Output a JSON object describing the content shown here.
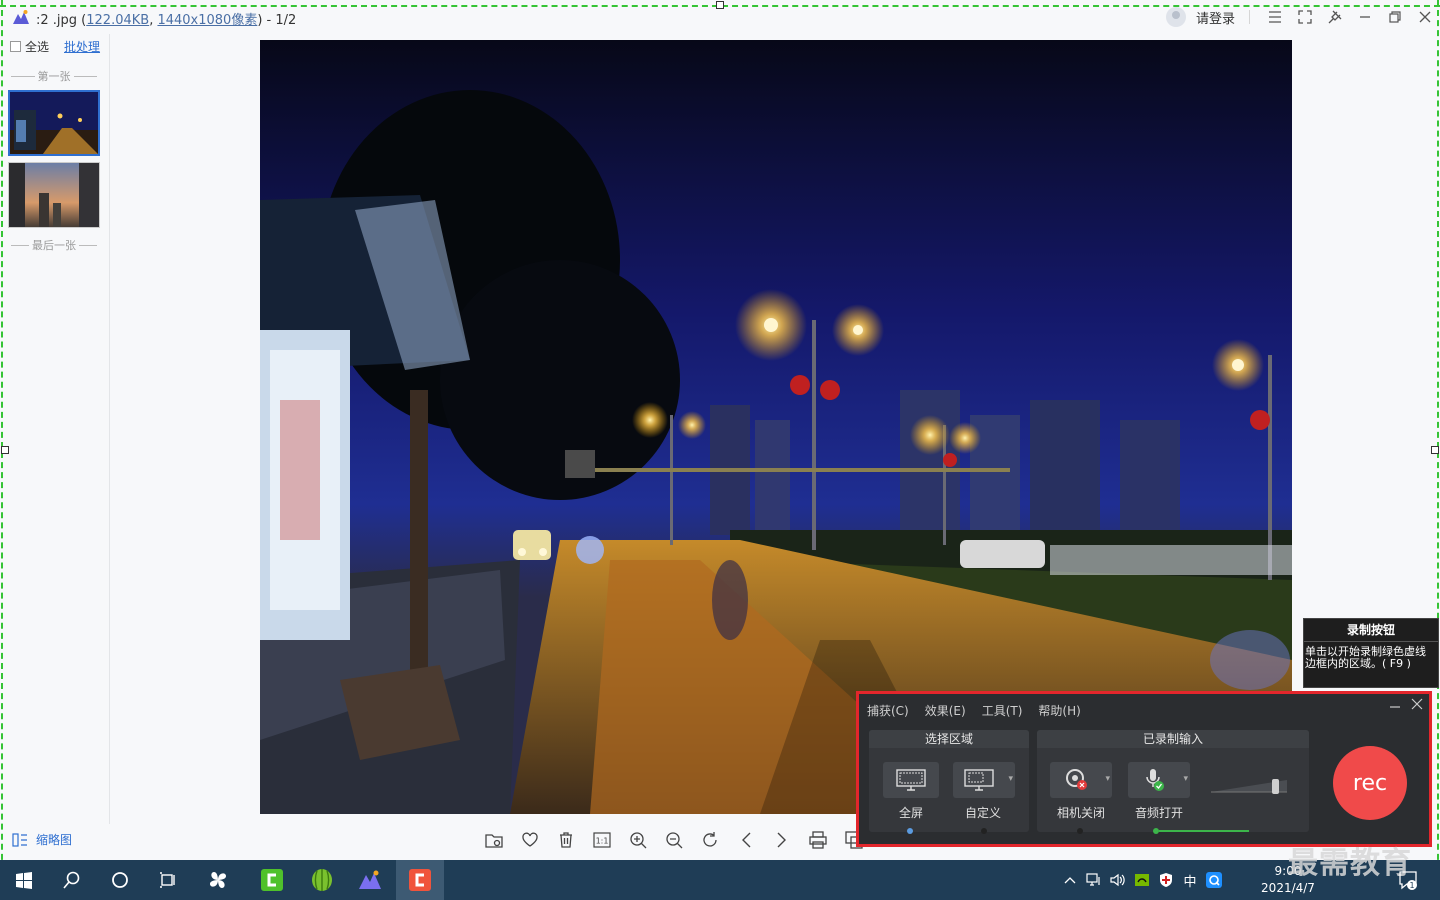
{
  "viewer": {
    "title_prefix": ":2 .jpg (",
    "file_size": "122.04KB",
    "title_sep": ", ",
    "dimensions": "1440x1080像素",
    "title_suffix": ") - 1/2",
    "login": "请登录",
    "select_all": "全选",
    "batch": "批处理",
    "first_label": "第一张",
    "last_label": "最后一张",
    "thumbnail_toggle": "缩略图",
    "toolbar_icons": [
      "folder-icon",
      "heart-icon",
      "trash-icon",
      "actual-size-icon",
      "zoom-in-icon",
      "zoom-out-icon",
      "rotate-icon",
      "prev-icon",
      "next-icon",
      "print-icon",
      "more-icon"
    ],
    "actual_size_text": "1:1"
  },
  "tooltip": {
    "title": "录制按钮",
    "body": "单击以开始录制绿色虚线边框内的区域。( F9 )"
  },
  "recorder": {
    "menu": [
      "捕获(C)",
      "效果(E)",
      "工具(T)",
      "帮助(H)"
    ],
    "area_title": "选择区域",
    "fullscreen": "全屏",
    "custom": "自定义",
    "input_title": "已录制输入",
    "camera": "相机关闭",
    "audio": "音频打开",
    "rec_label": "rec",
    "accent": "#f04a4a",
    "border_color": "#e3262c"
  },
  "taskbar": {
    "ime": "中",
    "time": "9:00",
    "date": "2021/4/7",
    "notif_count": "1"
  },
  "watermark": "最需教育"
}
